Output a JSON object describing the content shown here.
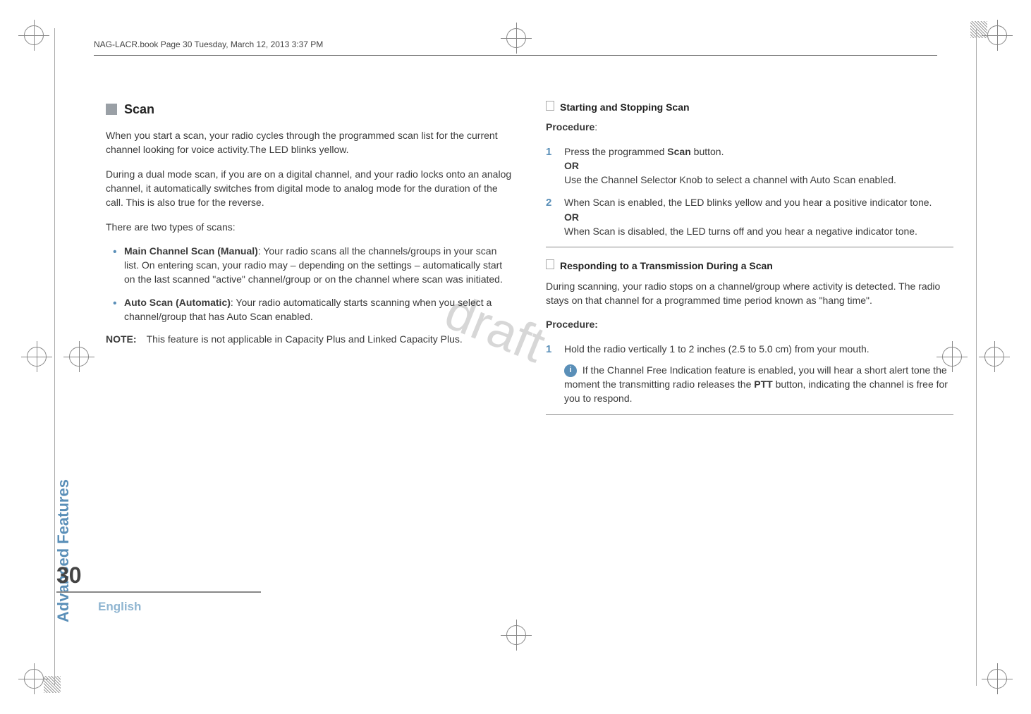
{
  "header": {
    "stamp": "NAG-LACR.book  Page 30  Tuesday, March 12, 2013  3:37 PM"
  },
  "watermark": "draft",
  "sidebar": {
    "label": "Advanced Features"
  },
  "footer": {
    "page_number": "30",
    "language": "English"
  },
  "left": {
    "section_title": "Scan",
    "p1": "When you start a scan, your radio cycles through the programmed scan list for the current channel looking for voice activity.The LED blinks yellow.",
    "p2": "During a dual mode scan, if you are on a digital channel, and your radio locks onto an analog channel, it automatically switches from digital mode to analog mode for the duration of the call. This is also true for the reverse.",
    "p3": "There are two types of scans:",
    "bullets": {
      "b1_bold": "Main Channel Scan (Manual)",
      "b1_rest": ": Your radio scans all the channels/groups in your scan list. On entering scan, your radio may – depending on the settings – automatically start on the last scanned \"active\" channel/group or on the channel where scan was initiated.",
      "b2_bold": "Auto Scan (Automatic)",
      "b2_rest": ": Your radio automatically starts scanning when you select a channel/group that has Auto Scan enabled."
    },
    "note_label": "NOTE:",
    "note_text": "This feature is not applicable in Capacity Plus and Linked Capacity Plus."
  },
  "right": {
    "sub1_title": "Starting and Stopping Scan",
    "proc_label": "Procedure",
    "proc_colon": ":",
    "step1_pre": "Press the programmed ",
    "step1_bold": "Scan",
    "step1_post": " button.",
    "or": "OR",
    "step1b": "Use the Channel Selector Knob to select a channel with Auto Scan enabled.",
    "step2a": "When Scan is enabled, the LED blinks yellow and you hear a positive indicator tone.",
    "step2b": "When Scan is disabled, the LED turns off and you hear a negative indicator tone.",
    "sub2_title": "Responding to a Transmission During a Scan",
    "p_resp": "During scanning, your radio stops on a channel/group where activity is detected. The radio stays on that channel for a programmed time period known as \"hang time\".",
    "proc2_label": "Procedure:",
    "r_step1": "Hold the radio vertically 1 to 2 inches (2.5 to 5.0 cm) from your mouth.",
    "info_pre": " If the Channel Free Indication feature is enabled, you will hear a short alert tone the moment the transmitting radio releases the ",
    "info_bold": "PTT",
    "info_post": " button, indicating the channel is free for you to respond."
  }
}
